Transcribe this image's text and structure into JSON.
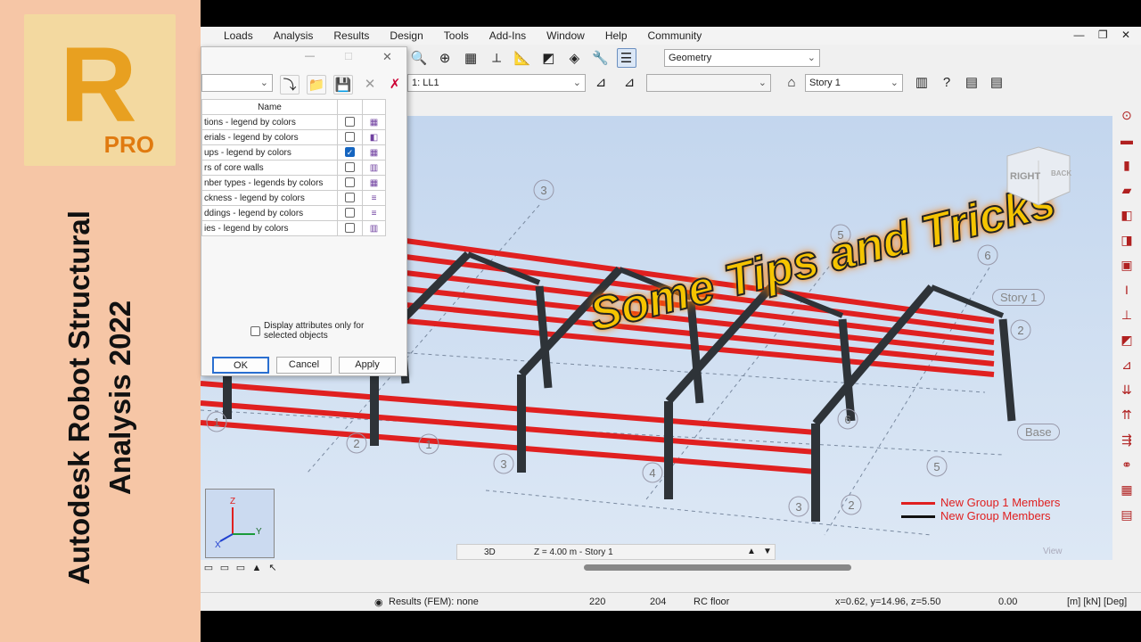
{
  "side_panel": {
    "logo_letter": "R",
    "logo_badge": "PRO",
    "title_line1": "Autodesk Robot Structural",
    "title_line2": "Analysis 2022"
  },
  "menu": [
    "Loads",
    "Analysis",
    "Results",
    "Design",
    "Tools",
    "Add-Ins",
    "Window",
    "Help",
    "Community"
  ],
  "toolbar": {
    "view_combo": "Geometry",
    "case_combo": "1: LL1",
    "story_combo": "Story 1"
  },
  "dialog": {
    "column_header": "Name",
    "rows": [
      {
        "label": "tions - legend by colors",
        "checked": false
      },
      {
        "label": "erials - legend by colors",
        "checked": false
      },
      {
        "label": "ups - legend by colors",
        "checked": true
      },
      {
        "label": "rs of core walls",
        "checked": false
      },
      {
        "label": "nber types - legends by colors",
        "checked": false
      },
      {
        "label": "ckness - legend by colors",
        "checked": false
      },
      {
        "label": "ddings - legend by colors",
        "checked": false
      },
      {
        "label": "ies - legend by colors",
        "checked": false
      }
    ],
    "display_attr_line1": "Display attributes only for",
    "display_attr_line2": "selected objects",
    "display_attr_checked": false,
    "ok": "OK",
    "cancel": "Cancel",
    "apply": "Apply"
  },
  "viewport": {
    "overlay_title": "Some Tips and Tricks",
    "cube_right": "RIGHT",
    "cube_back": "BACK",
    "story_label": "Story 1",
    "base_label": "Base",
    "grid_labels": [
      "3",
      "5",
      "6",
      "1",
      "2",
      "3",
      "4",
      "5",
      "6",
      "3",
      "2",
      "1",
      "2"
    ],
    "legend": [
      {
        "label": "New Group 1 Members",
        "color": "#e02020"
      },
      {
        "label": "New Group Members",
        "color": "#111111"
      }
    ],
    "axes": {
      "z": "Z",
      "y": "Y",
      "x": "X"
    }
  },
  "view_bar": {
    "mode": "3D",
    "level": "Z = 4.00 m - Story 1",
    "view": "View"
  },
  "status": {
    "results": "Results (FEM): none",
    "nodes": "220",
    "bars": "204",
    "section": "RC floor",
    "coords": "x=0.62, y=14.96, z=5.50",
    "angle": "0.00",
    "units": "[m] [kN] [Deg]"
  },
  "colors": {
    "member_red": "#e02020",
    "member_dark": "#2e3338",
    "viewport_bg": "#c9daef"
  }
}
